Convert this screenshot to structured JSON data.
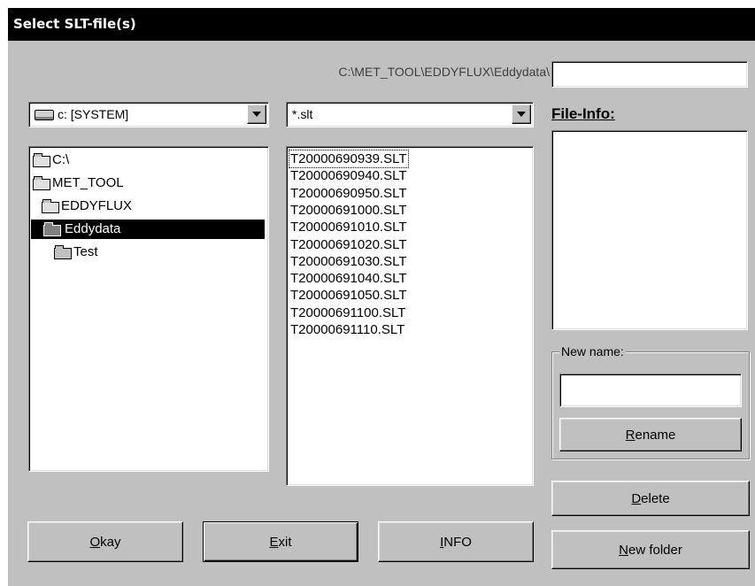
{
  "window": {
    "title": "Select SLT-file(s)"
  },
  "path": {
    "label": "C:\\MET_TOOL\\EDDYFLUX\\Eddydata\\",
    "filename_value": ""
  },
  "drive": {
    "selected": "c: [SYSTEM]",
    "icon": "drive-icon"
  },
  "filter": {
    "selected": "*.slt"
  },
  "tree": [
    {
      "label": "C:\\",
      "icon": "folder-open-icon"
    },
    {
      "label": "MET_TOOL",
      "icon": "folder-open-icon"
    },
    {
      "label": "EDDYFLUX",
      "icon": "folder-open-icon"
    },
    {
      "label": "Eddydata",
      "icon": "folder-open-icon",
      "selected": true
    },
    {
      "label": "Test",
      "icon": "folder-closed-icon"
    }
  ],
  "files": [
    "T20000690939.SLT",
    "T20000690940.SLT",
    "T20000690950.SLT",
    "T20000691000.SLT",
    "T20000691010.SLT",
    "T20000691020.SLT",
    "T20000691030.SLT",
    "T20000691040.SLT",
    "T20000691050.SLT",
    "T20000691100.SLT",
    "T20000691110.SLT"
  ],
  "file_info": {
    "heading": "File-Info:",
    "content": ""
  },
  "new_name": {
    "group_label": "New name:",
    "value": ""
  },
  "buttons": {
    "rename": {
      "acc": "R",
      "rest": "ename"
    },
    "delete": {
      "acc": "D",
      "rest": "elete"
    },
    "new_folder": {
      "acc": "N",
      "rest": "ew folder"
    },
    "okay": {
      "acc": "O",
      "rest": "kay"
    },
    "exit": {
      "acc": "E",
      "rest": "xit"
    },
    "info": {
      "acc": "I",
      "rest": "NFO"
    }
  }
}
